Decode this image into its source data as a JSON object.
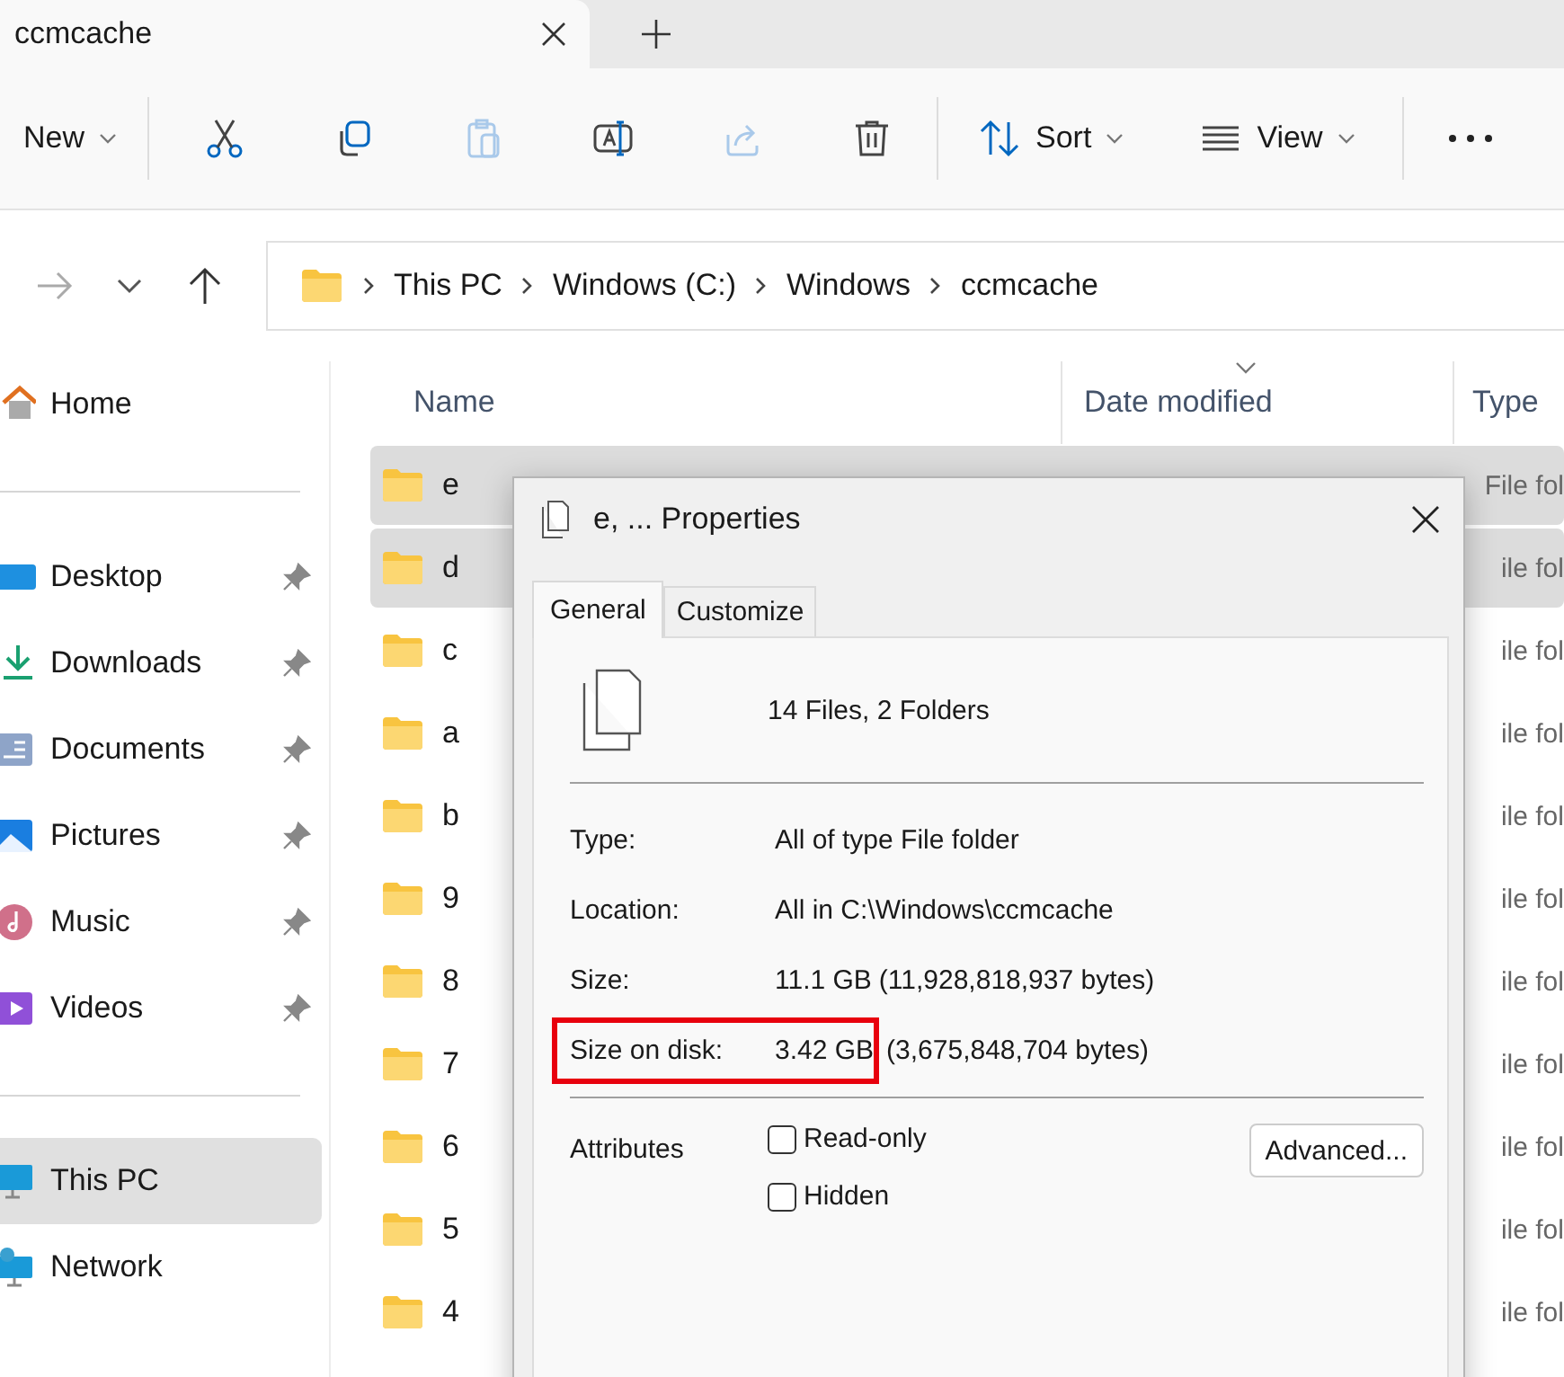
{
  "tab": {
    "title": "ccmcache"
  },
  "toolbar": {
    "new_label": "New",
    "sort_label": "Sort",
    "view_label": "View",
    "actions": [
      {
        "kind": "cut",
        "disabled": false
      },
      {
        "kind": "copy",
        "disabled": false
      },
      {
        "kind": "paste",
        "disabled": true
      },
      {
        "kind": "rename",
        "disabled": false
      },
      {
        "kind": "share",
        "disabled": true
      },
      {
        "kind": "delete",
        "disabled": false
      }
    ]
  },
  "navigation": {
    "forward_disabled": true
  },
  "breadcrumb": [
    "This PC",
    "Windows (C:)",
    "Windows",
    "ccmcache"
  ],
  "sidebar": {
    "items": [
      {
        "kind": "home",
        "label": "Home",
        "pinned": false,
        "selected": false
      },
      {
        "kind": "divider"
      },
      {
        "kind": "desktop",
        "label": "Desktop",
        "pinned": true,
        "selected": false
      },
      {
        "kind": "downloads",
        "label": "Downloads",
        "pinned": true,
        "selected": false
      },
      {
        "kind": "documents",
        "label": "Documents",
        "pinned": true,
        "selected": false
      },
      {
        "kind": "pictures",
        "label": "Pictures",
        "pinned": true,
        "selected": false
      },
      {
        "kind": "music",
        "label": "Music",
        "pinned": true,
        "selected": false
      },
      {
        "kind": "videos",
        "label": "Videos",
        "pinned": true,
        "selected": false
      },
      {
        "kind": "divider"
      },
      {
        "kind": "pc",
        "label": "This PC",
        "pinned": false,
        "selected": true
      },
      {
        "kind": "network",
        "label": "Network",
        "pinned": false,
        "selected": false
      }
    ]
  },
  "table": {
    "columns": [
      "Name",
      "Date modified",
      "Type"
    ],
    "rows": [
      {
        "name": "e",
        "type": "File fol",
        "selected": true
      },
      {
        "name": "d",
        "type": "ile fol",
        "selected": true
      },
      {
        "name": "c",
        "type": "ile fol",
        "selected": false
      },
      {
        "name": "a",
        "type": "ile fol",
        "selected": false
      },
      {
        "name": "b",
        "type": "ile fol",
        "selected": false
      },
      {
        "name": "9",
        "type": "ile fol",
        "selected": false
      },
      {
        "name": "8",
        "type": "ile fol",
        "selected": false
      },
      {
        "name": "7",
        "type": "ile fol",
        "selected": false
      },
      {
        "name": "6",
        "type": "ile fol",
        "selected": false
      },
      {
        "name": "5",
        "type": "ile fol",
        "selected": false
      },
      {
        "name": "4",
        "type": "ile fol",
        "selected": false
      }
    ]
  },
  "dialog": {
    "title": "e, ... Properties",
    "tabs": [
      {
        "label": "General",
        "selected": true
      },
      {
        "label": "Customize",
        "selected": false
      }
    ],
    "summary": "14 Files, 2 Folders",
    "properties": [
      {
        "label": "Type:",
        "value": "All of type File folder",
        "highlighted": false
      },
      {
        "label": "Location:",
        "value": "All in C:\\Windows\\ccmcache",
        "highlighted": false
      },
      {
        "label": "Size:",
        "value": "11.1 GB",
        "detail": "(11,928,818,937 bytes)",
        "highlighted": false
      },
      {
        "label": "Size on disk:",
        "value": "3.42 GB",
        "detail": "(3,675,848,704 bytes)",
        "highlighted": true
      }
    ],
    "attributes_label": "Attributes",
    "attributes": [
      {
        "label": "Read-only",
        "checked": false
      },
      {
        "label": "Hidden",
        "checked": false
      }
    ],
    "advanced_button": "Advanced..."
  }
}
